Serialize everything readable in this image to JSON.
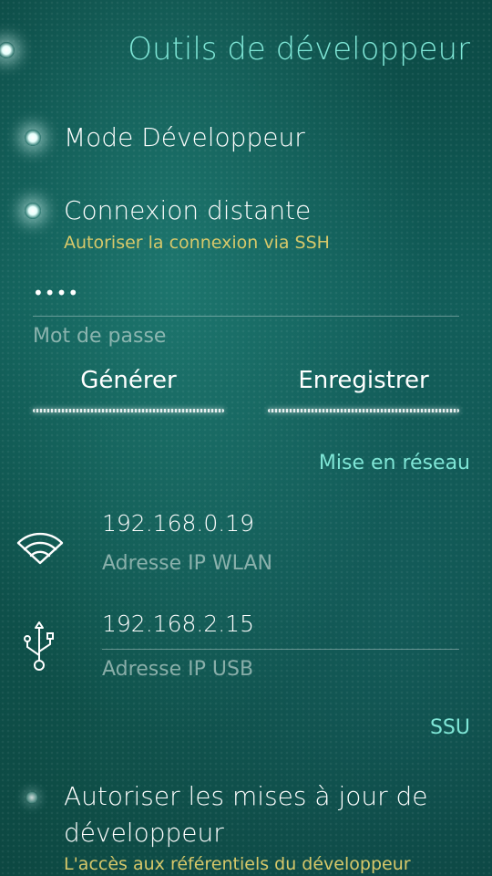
{
  "header": {
    "title": "Outils de développeur"
  },
  "developer_mode": {
    "label": "Mode Développeur"
  },
  "remote_connection": {
    "label": "Connexion distante",
    "description": "Autoriser la connexion via SSH"
  },
  "password": {
    "value": "••••",
    "label": "Mot de passe"
  },
  "buttons": {
    "generate": "Générer",
    "save": "Enregistrer"
  },
  "networking": {
    "section_title": "Mise en réseau",
    "wlan": {
      "ip": "192.168.0.19",
      "label": "Adresse IP WLAN",
      "icon": "wifi-icon"
    },
    "usb": {
      "ip": "192.168.2.15",
      "label": "Adresse IP USB",
      "icon": "usb-icon"
    }
  },
  "ssu": {
    "section_title": "SSU",
    "allow_updates_line1": "Autoriser les mises à jour de",
    "allow_updates_line2": "développeur",
    "allow_updates_description": "L'accès aux référentiels du développeur"
  }
}
